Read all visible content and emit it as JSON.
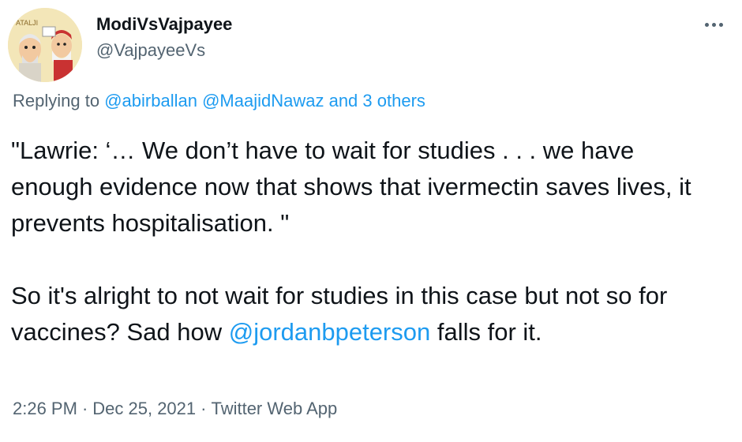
{
  "author": {
    "display_name": "ModiVsVajpayee",
    "handle": "@VajpayeeVs",
    "avatar_text": "ATALJI"
  },
  "replying": {
    "prefix": "Replying to",
    "mentions": [
      "@abirballan",
      "@MaajidNawaz"
    ],
    "others": "and 3 others"
  },
  "body": {
    "paragraph1": "\"Lawrie: ‘… We don’t have to wait for studies . . . we have enough evidence now that shows that ivermectin saves lives, it prevents hospitalisation. \"",
    "paragraph2_before": "So it's alright to not wait for studies in this case but not so for vaccines? Sad how ",
    "paragraph2_mention": "@jordanbpeterson",
    "paragraph2_after": " falls for it."
  },
  "meta": {
    "time": "2:26 PM",
    "date": "Dec 25, 2021",
    "source": "Twitter Web App",
    "separator": "·"
  },
  "icons": {
    "more": "more-horizontal-icon"
  },
  "colors": {
    "link": "#1d9bf0",
    "secondary_text": "#536471",
    "primary_text": "#0f1419"
  }
}
